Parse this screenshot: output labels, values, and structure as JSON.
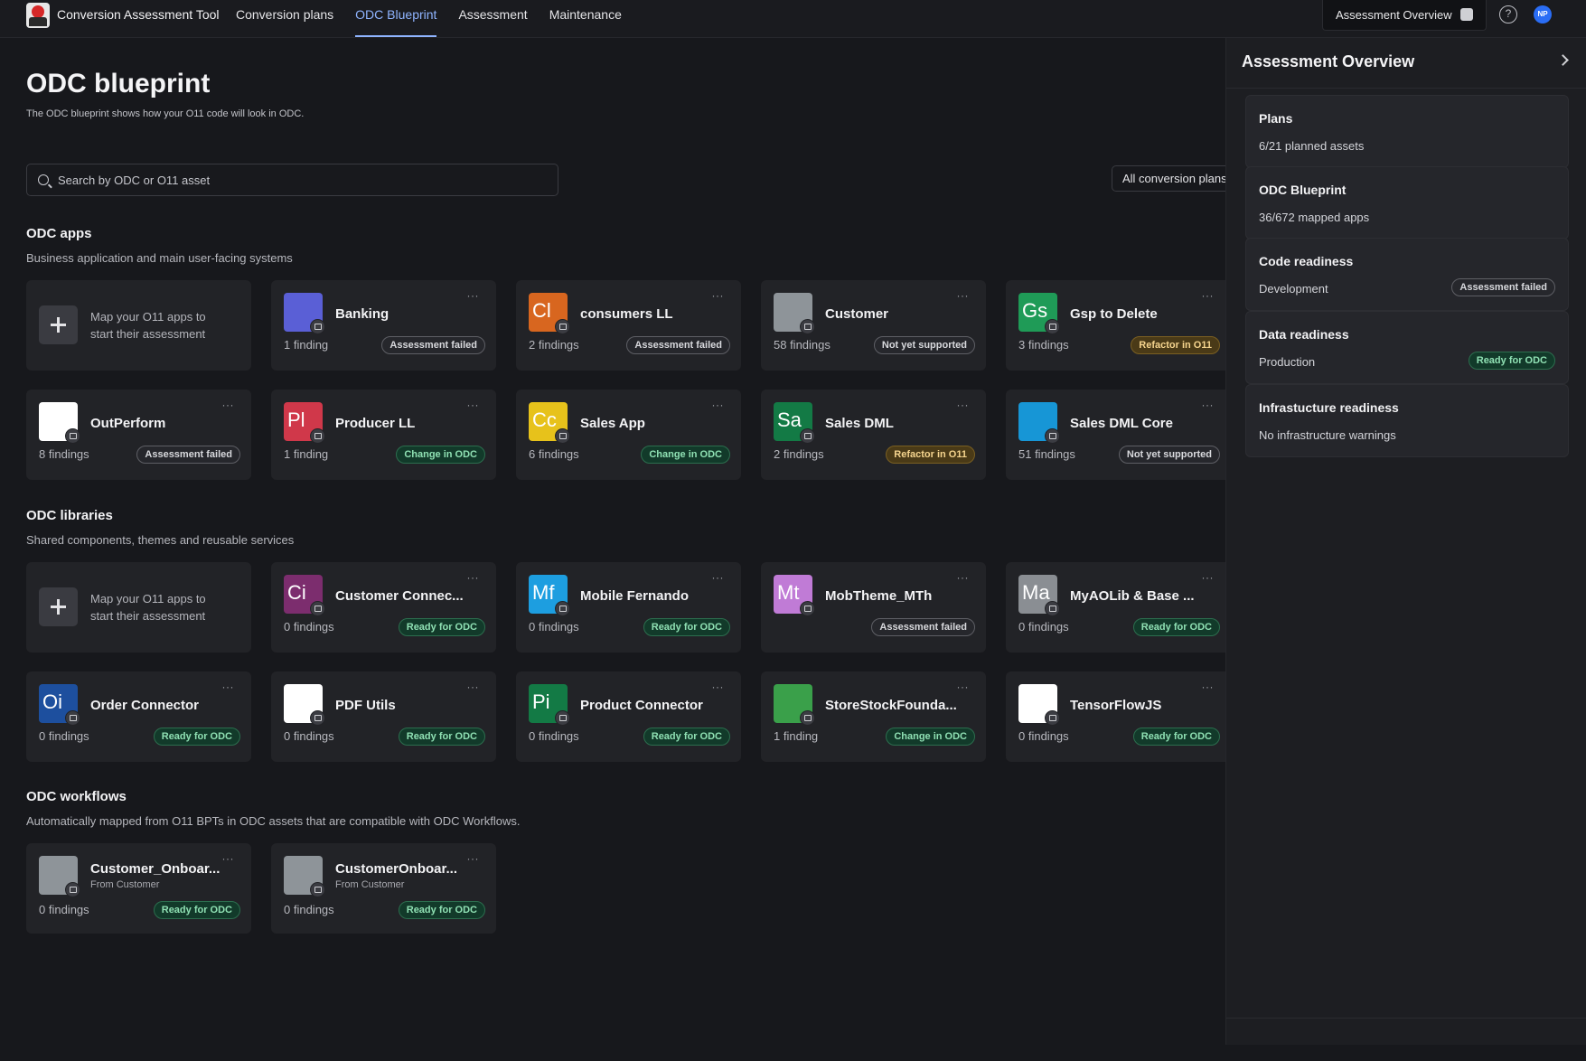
{
  "app": {
    "title": "Conversion Assessment Tool"
  },
  "nav": {
    "items": [
      {
        "label": "Conversion plans"
      },
      {
        "label": "ODC Blueprint"
      },
      {
        "label": "Assessment"
      },
      {
        "label": "Maintenance"
      }
    ]
  },
  "header": {
    "overview_toggle": "Assessment Overview",
    "help": "?",
    "avatar": "NP"
  },
  "page": {
    "title": "ODC blueprint",
    "subtitle": "The ODC blueprint shows how your O11 code will look in ODC.",
    "search_placeholder": "Search by ODC or O11 asset",
    "plan_filter": "All conversion plans"
  },
  "sections": {
    "apps": {
      "title": "ODC apps",
      "desc": "Business application and main user-facing systems",
      "add_text": "Map your O11 apps to start their assessment",
      "items": [
        {
          "name": "Banking",
          "initials": "",
          "icon": "banking-app-icon",
          "color": "#5a5fd6",
          "findings": "1 finding",
          "status": "Assessment failed",
          "kind": "failed"
        },
        {
          "name": "consumers LL",
          "initials": "Cl",
          "icon": "consumers-ll-app-icon",
          "color": "#d8661f",
          "findings": "2 findings",
          "status": "Assessment failed",
          "kind": "failed"
        },
        {
          "name": "Customer",
          "initials": "",
          "icon": "puzzle-icon",
          "color": "#8e9499",
          "findings": "58 findings",
          "status": "Not yet supported",
          "kind": "unsupported"
        },
        {
          "name": "Gsp to Delete",
          "initials": "Gs",
          "icon": "gsp-app-icon",
          "color": "#1f9b57",
          "findings": "3 findings",
          "status": "Refactor in O11",
          "kind": "refactor"
        },
        {
          "name": "OutPerform",
          "initials": "",
          "icon": "outperform-logo-icon",
          "color": "#ffffff",
          "findings": "8 findings",
          "status": "Assessment failed",
          "kind": "failed"
        },
        {
          "name": "Producer LL",
          "initials": "Pl",
          "icon": "producer-ll-app-icon",
          "color": "#d0384a",
          "findings": "1 finding",
          "status": "Change in ODC",
          "kind": "change"
        },
        {
          "name": "Sales App",
          "initials": "Cc",
          "icon": "sales-app-icon",
          "color": "#e7c21b",
          "findings": "6 findings",
          "status": "Change in ODC",
          "kind": "change"
        },
        {
          "name": "Sales DML",
          "initials": "Sa",
          "icon": "sales-dml-app-icon",
          "color": "#137a45",
          "findings": "2 findings",
          "status": "Refactor in O11",
          "kind": "refactor"
        },
        {
          "name": "Sales DML Core",
          "initials": "",
          "icon": "salesforce-cloud-icon",
          "color": "#1796d6",
          "findings": "51 findings",
          "status": "Not yet supported",
          "kind": "unsupported"
        }
      ]
    },
    "libraries": {
      "title": "ODC libraries",
      "desc": "Shared components, themes and reusable services",
      "add_text": "Map your O11 apps to start their assessment",
      "items": [
        {
          "name": "Customer Connec...",
          "initials": "Ci",
          "icon": "customer-connector-lib-icon",
          "color": "#7c2d6e",
          "findings": "0 findings",
          "status": "Ready for ODC",
          "kind": "ready"
        },
        {
          "name": "Mobile Fernando",
          "initials": "Mf",
          "icon": "mobile-fernando-lib-icon",
          "color": "#1d9ee0",
          "findings": "0 findings",
          "status": "Ready for ODC",
          "kind": "ready"
        },
        {
          "name": "MobTheme_MTh",
          "initials": "Mt",
          "icon": "mobtheme-lib-icon",
          "color": "#c07bd6",
          "findings": "",
          "status": "Assessment failed",
          "kind": "failed"
        },
        {
          "name": "MyAOLib & Base ...",
          "initials": "Ma",
          "icon": "myaolib-lib-icon",
          "color": "#8a8e93",
          "findings": "0 findings",
          "status": "Ready for ODC",
          "kind": "ready"
        },
        {
          "name": "Order Connector",
          "initials": "Oi",
          "icon": "order-connector-lib-icon",
          "color": "#1d4f9e",
          "findings": "0 findings",
          "status": "Ready for ODC",
          "kind": "ready"
        },
        {
          "name": "PDF Utils",
          "initials": "",
          "icon": "pdf-file-icon",
          "color": "#ffffff",
          "findings": "0 findings",
          "status": "Ready for ODC",
          "kind": "ready"
        },
        {
          "name": "Product Connector",
          "initials": "Pi",
          "icon": "product-connector-lib-icon",
          "color": "#137a45",
          "findings": "0 findings",
          "status": "Ready for ODC",
          "kind": "ready"
        },
        {
          "name": "StoreStockFounda...",
          "initials": "",
          "icon": "leaf-logo-icon",
          "color": "#3aa04a",
          "findings": "1 finding",
          "status": "Change in ODC",
          "kind": "change"
        },
        {
          "name": "TensorFlowJS",
          "initials": "",
          "icon": "tensorflow-logo-icon",
          "color": "#ffffff",
          "findings": "0 findings",
          "status": "Ready for ODC",
          "kind": "ready"
        }
      ]
    },
    "workflows": {
      "title": "ODC workflows",
      "desc": "Automatically mapped from O11 BPTs in ODC assets that are compatible with ODC Workflows.",
      "items": [
        {
          "name": "Customer_Onboar...",
          "from": "From Customer",
          "icon": "puzzle-icon",
          "color": "#8e9499",
          "findings": "0 findings",
          "status": "Ready for ODC",
          "kind": "ready"
        },
        {
          "name": "CustomerOnboar...",
          "from": "From Customer",
          "icon": "puzzle-icon",
          "color": "#8e9499",
          "findings": "0 findings",
          "status": "Ready for ODC",
          "kind": "ready"
        }
      ]
    }
  },
  "overview": {
    "title": "Assessment Overview",
    "cards": [
      {
        "title": "Plans",
        "value": "6/21 planned assets",
        "status": ""
      },
      {
        "title": "ODC Blueprint",
        "value": "36/672 mapped apps",
        "status": ""
      },
      {
        "title": "Code readiness",
        "value": "Development",
        "status": "Assessment failed",
        "kind": "failed"
      },
      {
        "title": "Data readiness",
        "value": "Production",
        "status": "Ready for ODC",
        "kind": "ready"
      },
      {
        "title": "Infrastucture readiness",
        "value": "No infrastructure warnings",
        "status": ""
      }
    ]
  }
}
